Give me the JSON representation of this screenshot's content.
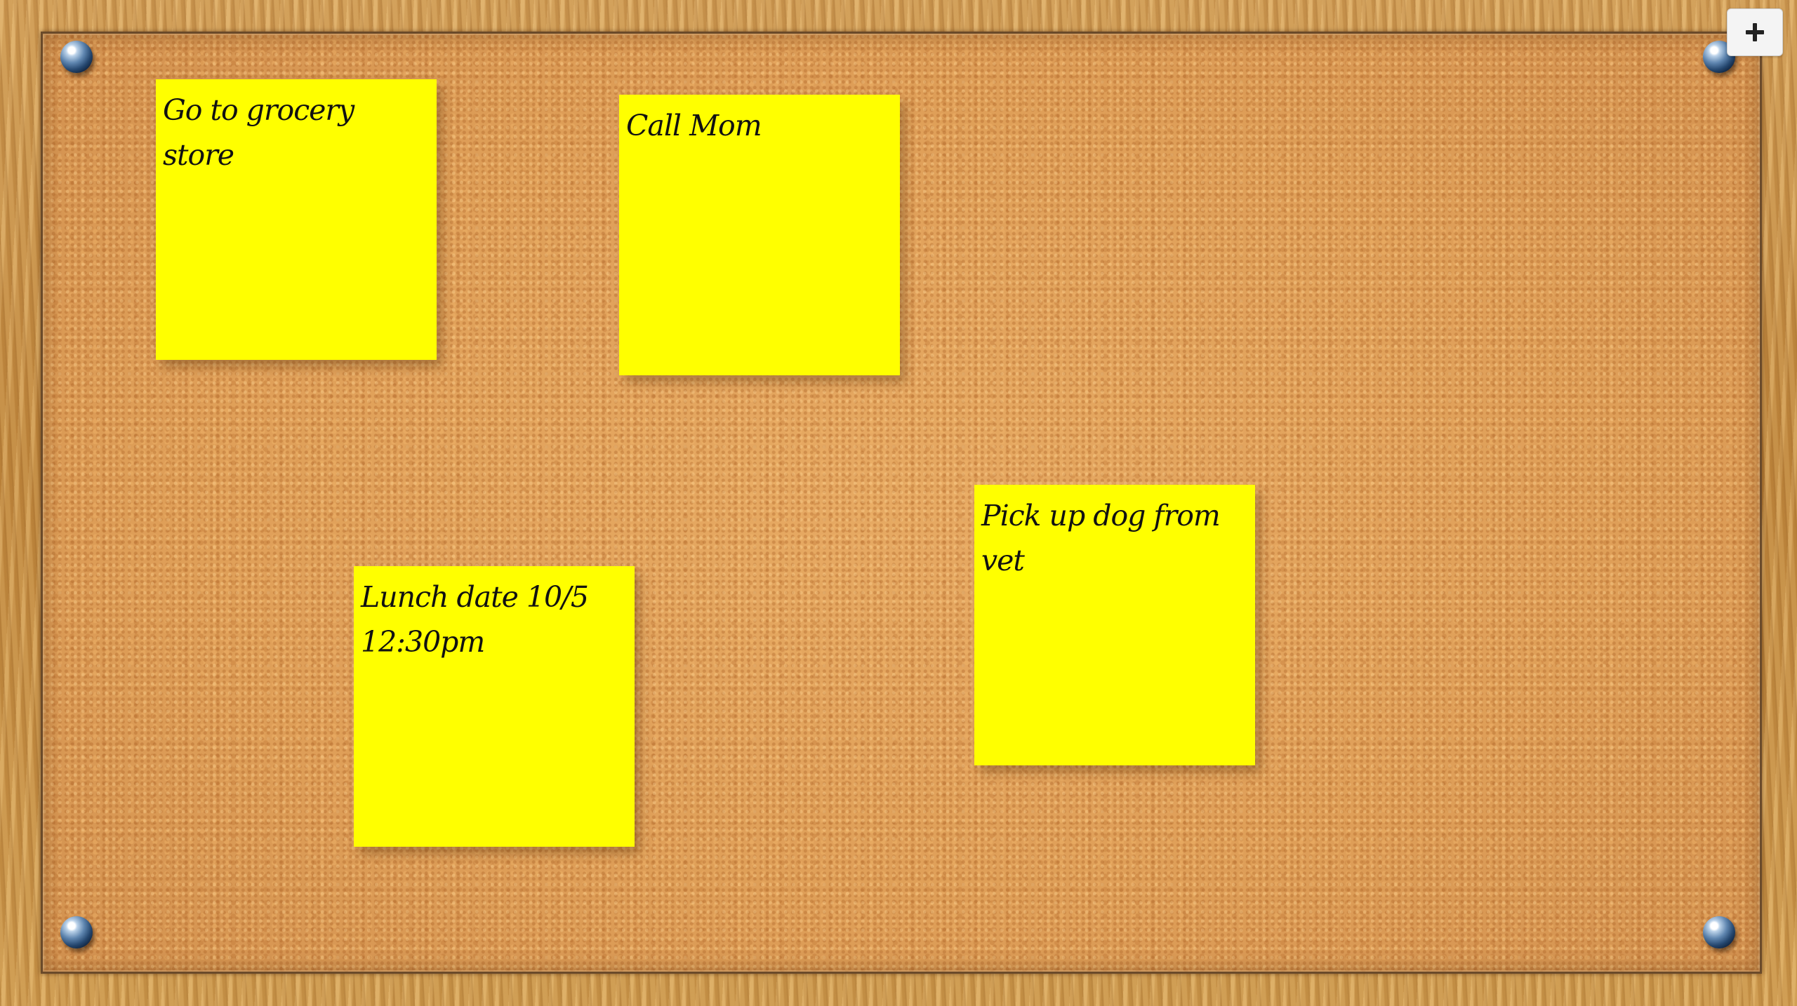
{
  "toolbar": {
    "add_button_icon": "plus-icon"
  },
  "notes": [
    {
      "text": "Go to grocery store"
    },
    {
      "text": "Call Mom"
    },
    {
      "text": "Lunch date 10/5\n12:30pm"
    },
    {
      "text": "Pick up dog from vet"
    }
  ],
  "colors": {
    "note": "#ffff00",
    "cork": "#df9f58",
    "frame": "#c98f42",
    "pin": "#5f86b0"
  }
}
